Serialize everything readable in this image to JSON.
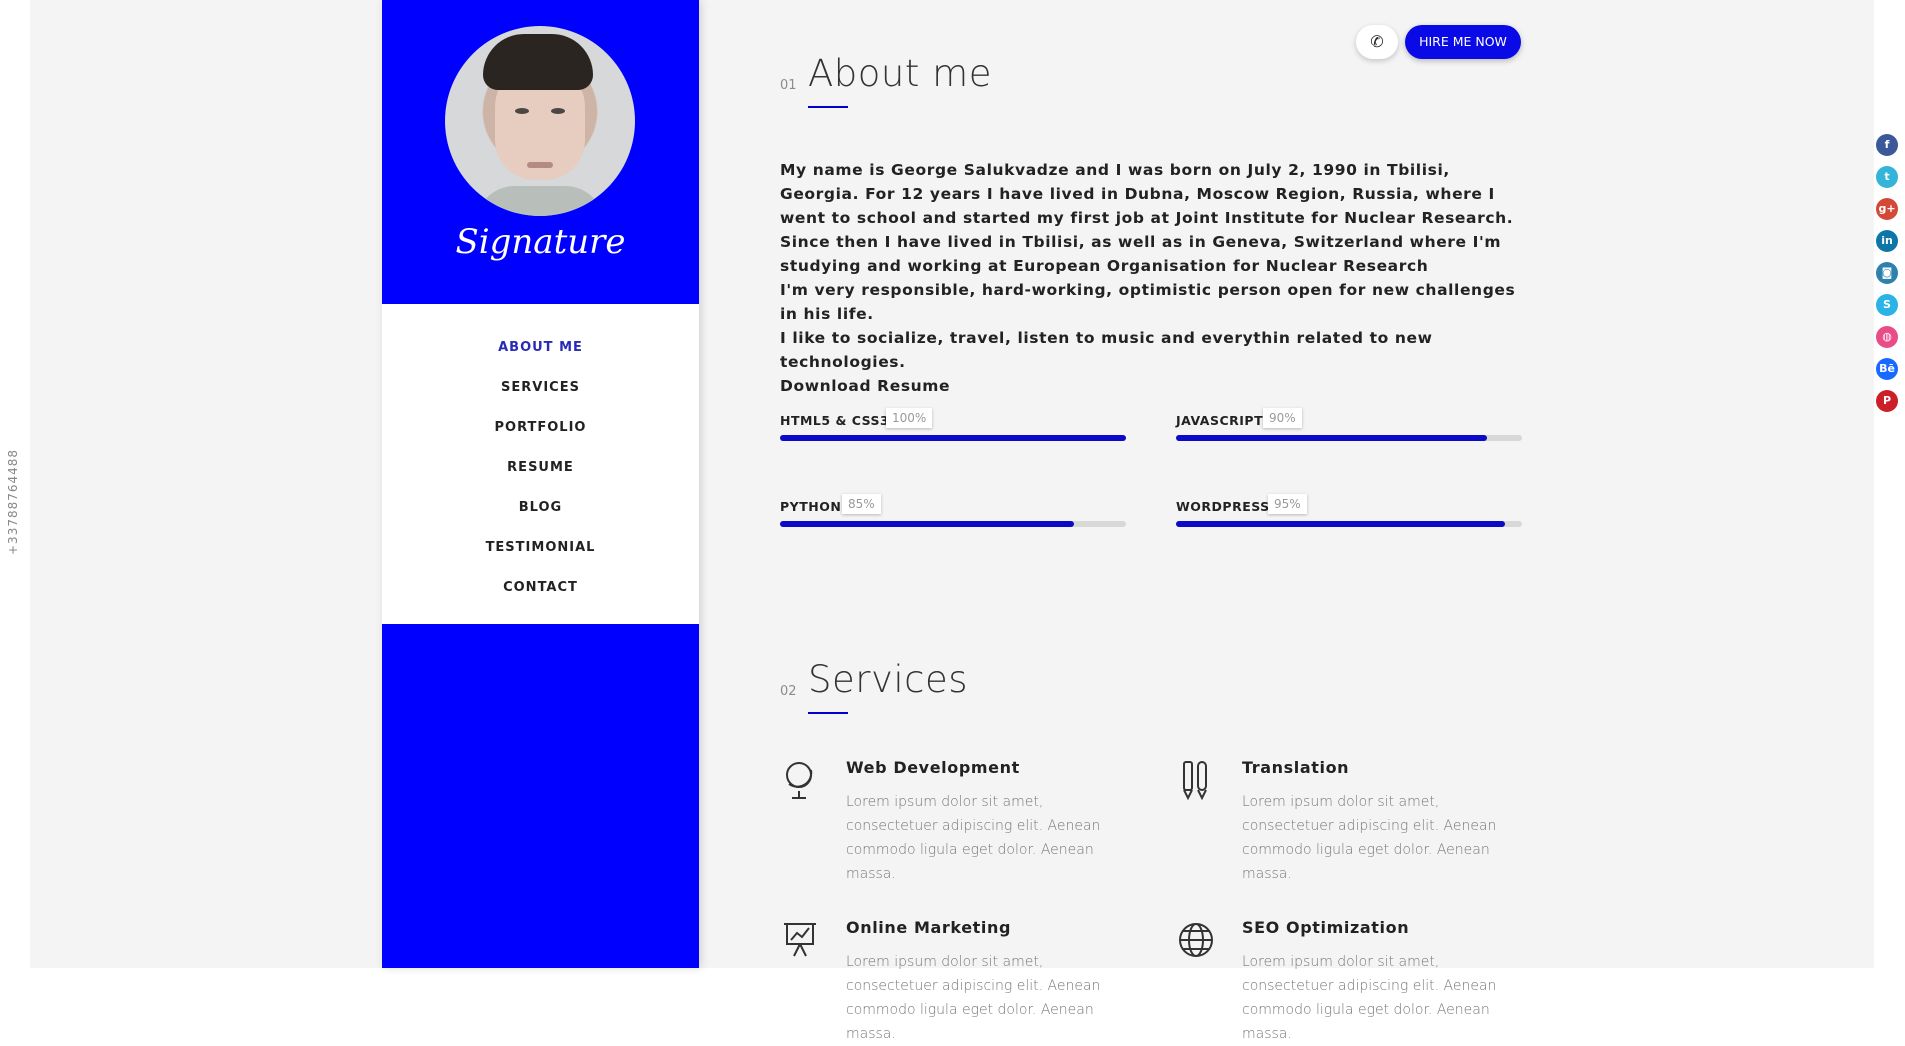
{
  "side_phone": "+33788764488",
  "profile": {
    "signature": "Signature"
  },
  "nav": {
    "items": [
      {
        "label": "ABOUT ME",
        "active": true
      },
      {
        "label": "SERVICES",
        "active": false
      },
      {
        "label": "PORTFOLIO",
        "active": false
      },
      {
        "label": "RESUME",
        "active": false
      },
      {
        "label": "BLOG",
        "active": false
      },
      {
        "label": "TESTIMONIAL",
        "active": false
      },
      {
        "label": "CONTACT",
        "active": false
      }
    ]
  },
  "header": {
    "call_icon": "phone-icon",
    "hire_label": "HIRE ME NOW"
  },
  "about": {
    "number": "01",
    "title": "About me",
    "paragraphs": [
      "My name is George Salukvadze and I was born on July 2, 1990 in Tbilisi, Georgia. For 12 years I have lived in Dubna, Moscow Region, Russia, where I went to school and started my first job at Joint Institute for Nuclear Research.",
      "Since then I have lived in Tbilisi, as well as in Geneva, Switzerland where I'm studying and working at European Organisation for Nuclear Research",
      "I'm very responsible, hard-working, optimistic person open for new challenges in his life.",
      "I like to socialize, travel, listen to music and everythin related to new technologies.",
      "Download Resume"
    ],
    "skills": [
      {
        "name": "HTML5 & CSS3",
        "percent_label": "100%",
        "value": 100
      },
      {
        "name": "JAVASCRIPT",
        "percent_label": "90%",
        "value": 90
      },
      {
        "name": "PYTHON",
        "percent_label": "85%",
        "value": 85
      },
      {
        "name": "WORDPRESS",
        "percent_label": "95%",
        "value": 95
      }
    ]
  },
  "services": {
    "number": "02",
    "title": "Services",
    "items": [
      {
        "title": "Web Development",
        "icon": "globe-stand-icon",
        "text": "Lorem ipsum dolor sit amet, consectetuer adipiscing elit. Aenean commodo ligula eget dolor. Aenean massa."
      },
      {
        "title": "Translation",
        "icon": "pens-icon",
        "text": "Lorem ipsum dolor sit amet, consectetuer adipiscing elit. Aenean commodo ligula eget dolor. Aenean massa."
      },
      {
        "title": "Online Marketing",
        "icon": "presentation-chart-icon",
        "text": "Lorem ipsum dolor sit amet, consectetuer adipiscing elit. Aenean commodo ligula eget dolor. Aenean massa."
      },
      {
        "title": "SEO Optimization",
        "icon": "world-grid-icon",
        "text": "Lorem ipsum dolor sit amet, consectetuer adipiscing elit. Aenean commodo ligula eget dolor. Aenean massa."
      }
    ]
  },
  "social": [
    {
      "name": "facebook-icon",
      "glyph": "f",
      "color": "#3b5998"
    },
    {
      "name": "twitter-icon",
      "glyph": "t",
      "color": "#33b4d8"
    },
    {
      "name": "google-plus-icon",
      "glyph": "g+",
      "color": "#d34836"
    },
    {
      "name": "linkedin-icon",
      "glyph": "in",
      "color": "#0e76a8"
    },
    {
      "name": "instagram-icon",
      "glyph": "◙",
      "color": "#2e80ad"
    },
    {
      "name": "skype-icon",
      "glyph": "S",
      "color": "#2ab3e6"
    },
    {
      "name": "dribbble-icon",
      "glyph": "◍",
      "color": "#ea4c89"
    },
    {
      "name": "behance-icon",
      "glyph": "Bē",
      "color": "#1769ff"
    },
    {
      "name": "pinterest-icon",
      "glyph": "P",
      "color": "#cb2027"
    }
  ],
  "colors": {
    "accent": "#0000ff",
    "skill_fill": "#0a0ac8",
    "nav_active": "#2a2ab8"
  }
}
